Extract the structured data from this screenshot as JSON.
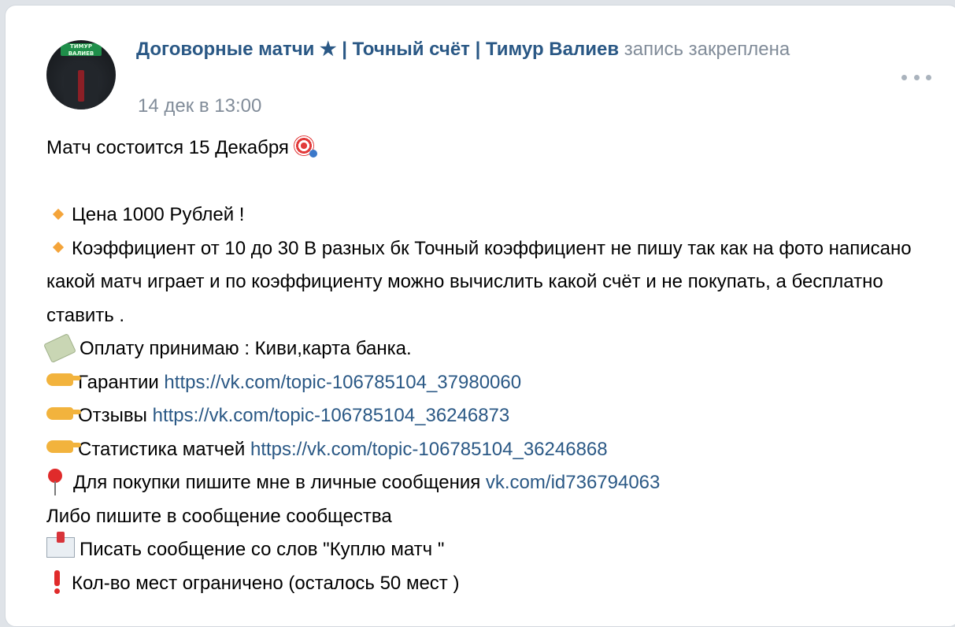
{
  "post": {
    "author_name": "Договорные матчи ★ | Точный счёт | Тимур Валиев",
    "pinned_note": "запись закреплена",
    "date": "14 дек в 13:00",
    "avatar_text": "ТИМУР ВАЛИЕВ",
    "lines": {
      "match_date": "Матч состоится 15 Декабря",
      "price": "Цена 1000 Рублей !",
      "coef": "Коэффициент от 10 до 30 В разных бк Точный коэффициент не пишу так как на фото написано какой матч играет и по коэффициенту можно вычислить какой счёт и не покупать, а бесплатно ставить .",
      "payment": "Оплату принимаю : Киви,карта банка.",
      "guarantees_label": "Гарантии",
      "guarantees_link": "https://vk.com/topic-106785104_37980060",
      "reviews_label": "Отзывы",
      "reviews_link": "https://vk.com/topic-106785104_36246873",
      "stats_label": "Статистика матчей",
      "stats_link": "https://vk.com/topic-106785104_36246868",
      "buy_label": "Для покупки пишите мне в личные сообщения",
      "buy_link": "vk.com/id736794063",
      "community": "Либо пишите в сообщение сообщества",
      "write": "Писать сообщение со слов \"Куплю матч \"",
      "limited": "Кол-во мест ограничено (осталось 50 мест )"
    }
  },
  "icons": {
    "target": "target-icon",
    "diamond": "orange-diamond-icon",
    "money": "money-wings-icon",
    "finger": "pointing-finger-icon",
    "pin": "round-pushpin-icon",
    "envelope": "envelope-arrow-icon",
    "exclamation": "exclamation-icon",
    "more": "more-options-icon"
  },
  "colors": {
    "link": "#2a5885",
    "meta": "#818c99",
    "text": "#000000"
  }
}
